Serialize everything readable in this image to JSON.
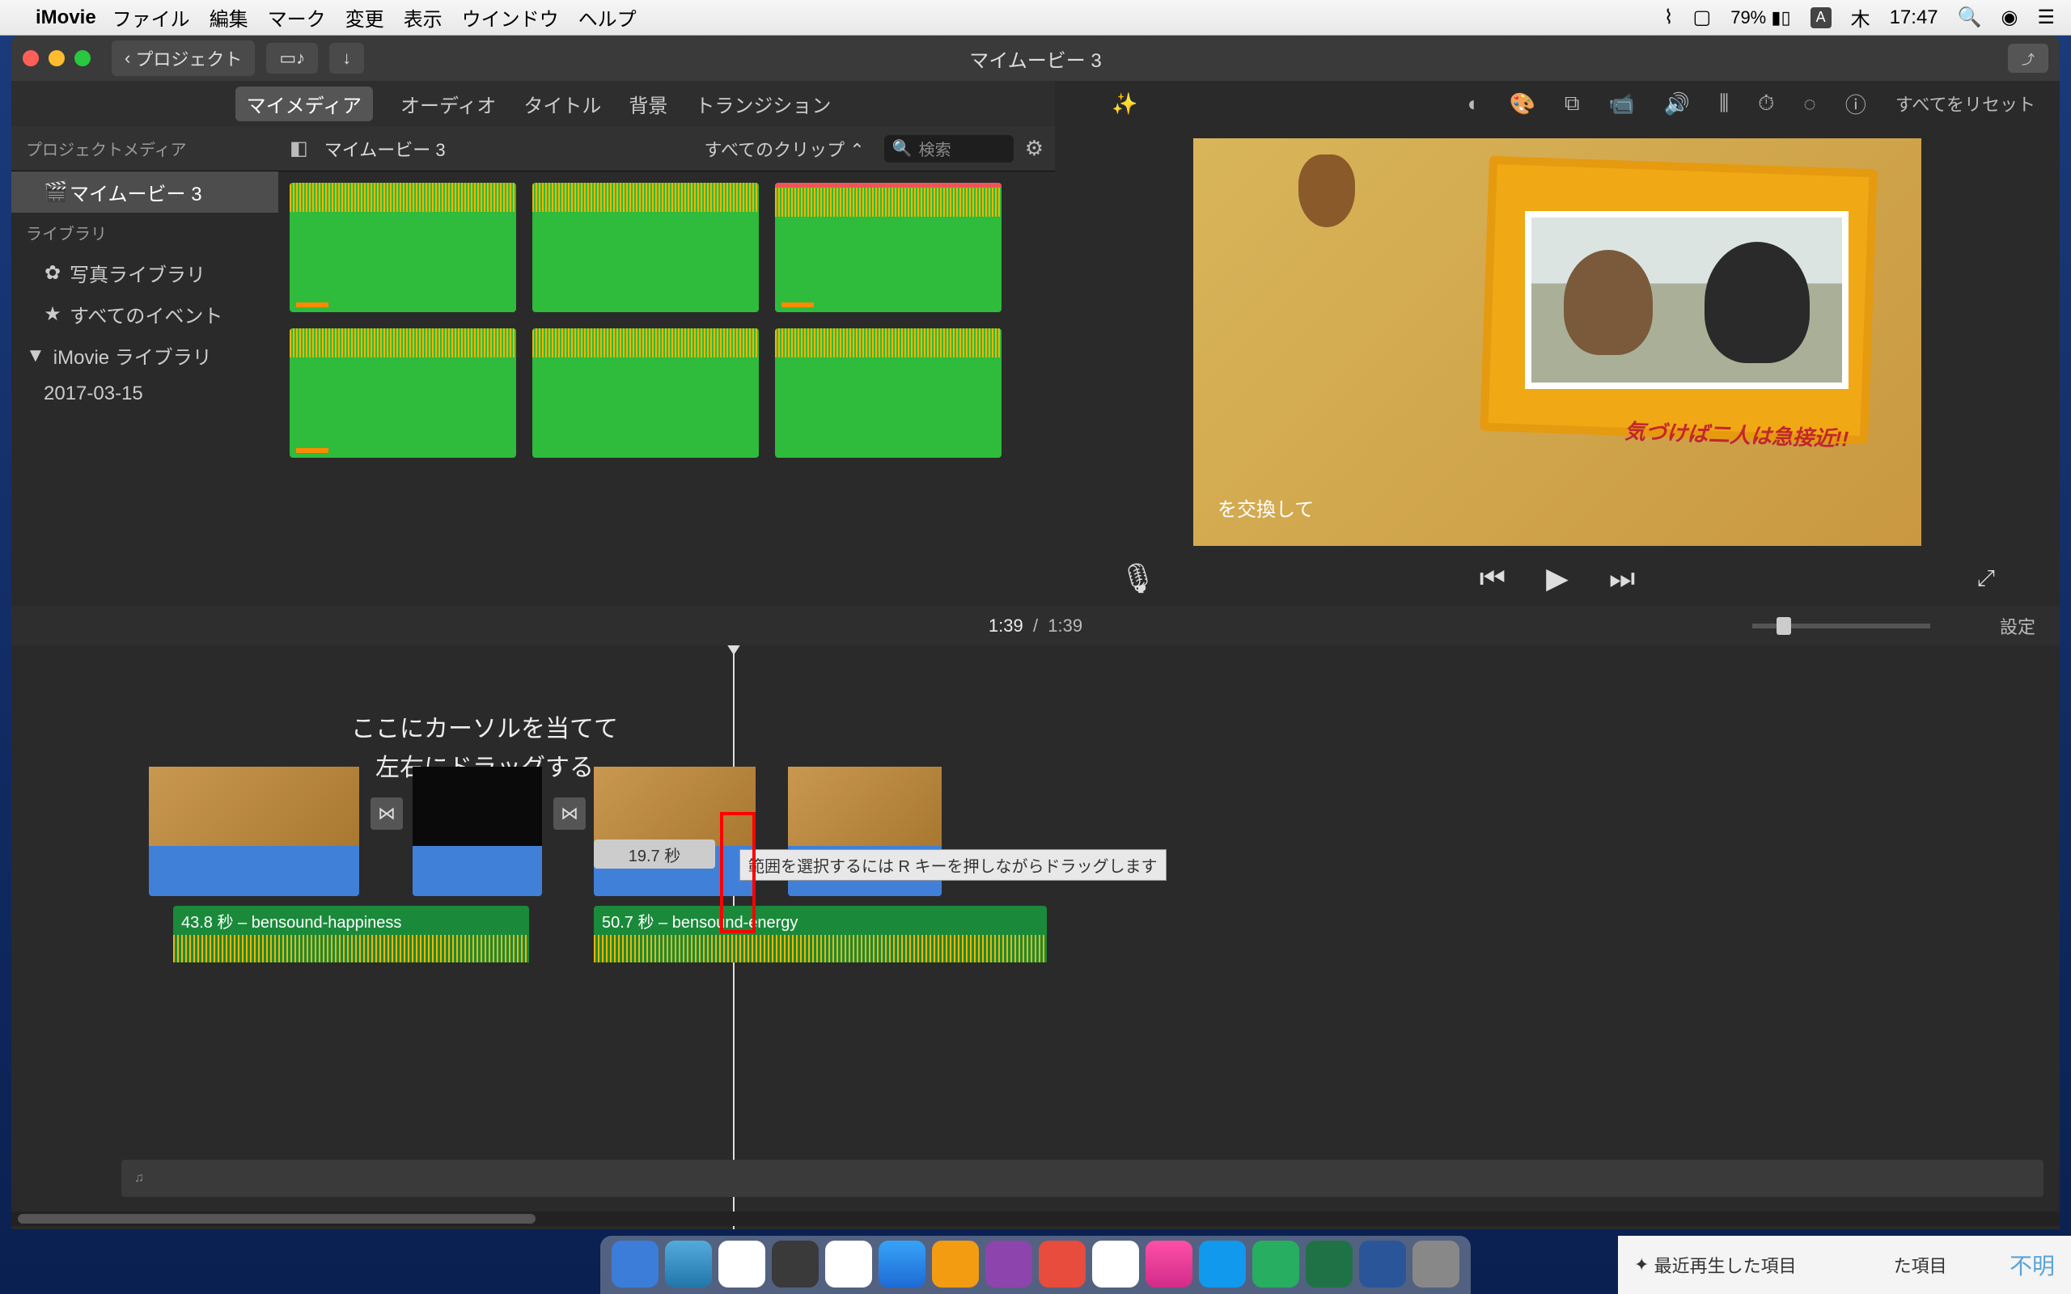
{
  "menubar": {
    "app": "iMovie",
    "items": [
      "ファイル",
      "編集",
      "マーク",
      "変更",
      "表示",
      "ウインドウ",
      "ヘルプ"
    ],
    "battery": "79%",
    "ime": "A",
    "day": "木",
    "time": "17:47"
  },
  "window": {
    "back_label": "プロジェクト",
    "title": "マイムービー 3"
  },
  "tabs": {
    "mymedia": "マイメディア",
    "audio": "オーディオ",
    "titles": "タイトル",
    "backgrounds": "背景",
    "transitions": "トランジション"
  },
  "browser": {
    "project": "マイムービー 3",
    "filter": "すべてのクリップ",
    "search_placeholder": "検索"
  },
  "sidebar": {
    "header1": "プロジェクトメディア",
    "items": [
      "マイムービー 3"
    ],
    "header2": "ライブラリ",
    "photos": "写真ライブラリ",
    "all_events": "すべてのイベント",
    "imovie_lib": "iMovie ライブラリ",
    "date": "2017-03-15"
  },
  "preview": {
    "caption": "気づけば二人は急接近!!",
    "subtitle": "を交換して"
  },
  "adjust": {
    "reset": "すべてをリセット"
  },
  "timeline_header": {
    "current": "1:39",
    "total": "1:39",
    "settings": "設定"
  },
  "annotation": {
    "line1": "ここにカーソルを当てて",
    "line2": "左右にドラッグする"
  },
  "clips": {
    "duration_tip": "19.7 秒",
    "tooltip": "範囲を選択するには R キーを押しながらドラッグします",
    "audio1": "43.8 秒 – bensound-happiness",
    "audio2": "50.7 秒 – bensound-energy"
  },
  "finder": {
    "recent": "最近再生した項目",
    "items": "た項目",
    "unknown": "不明"
  }
}
